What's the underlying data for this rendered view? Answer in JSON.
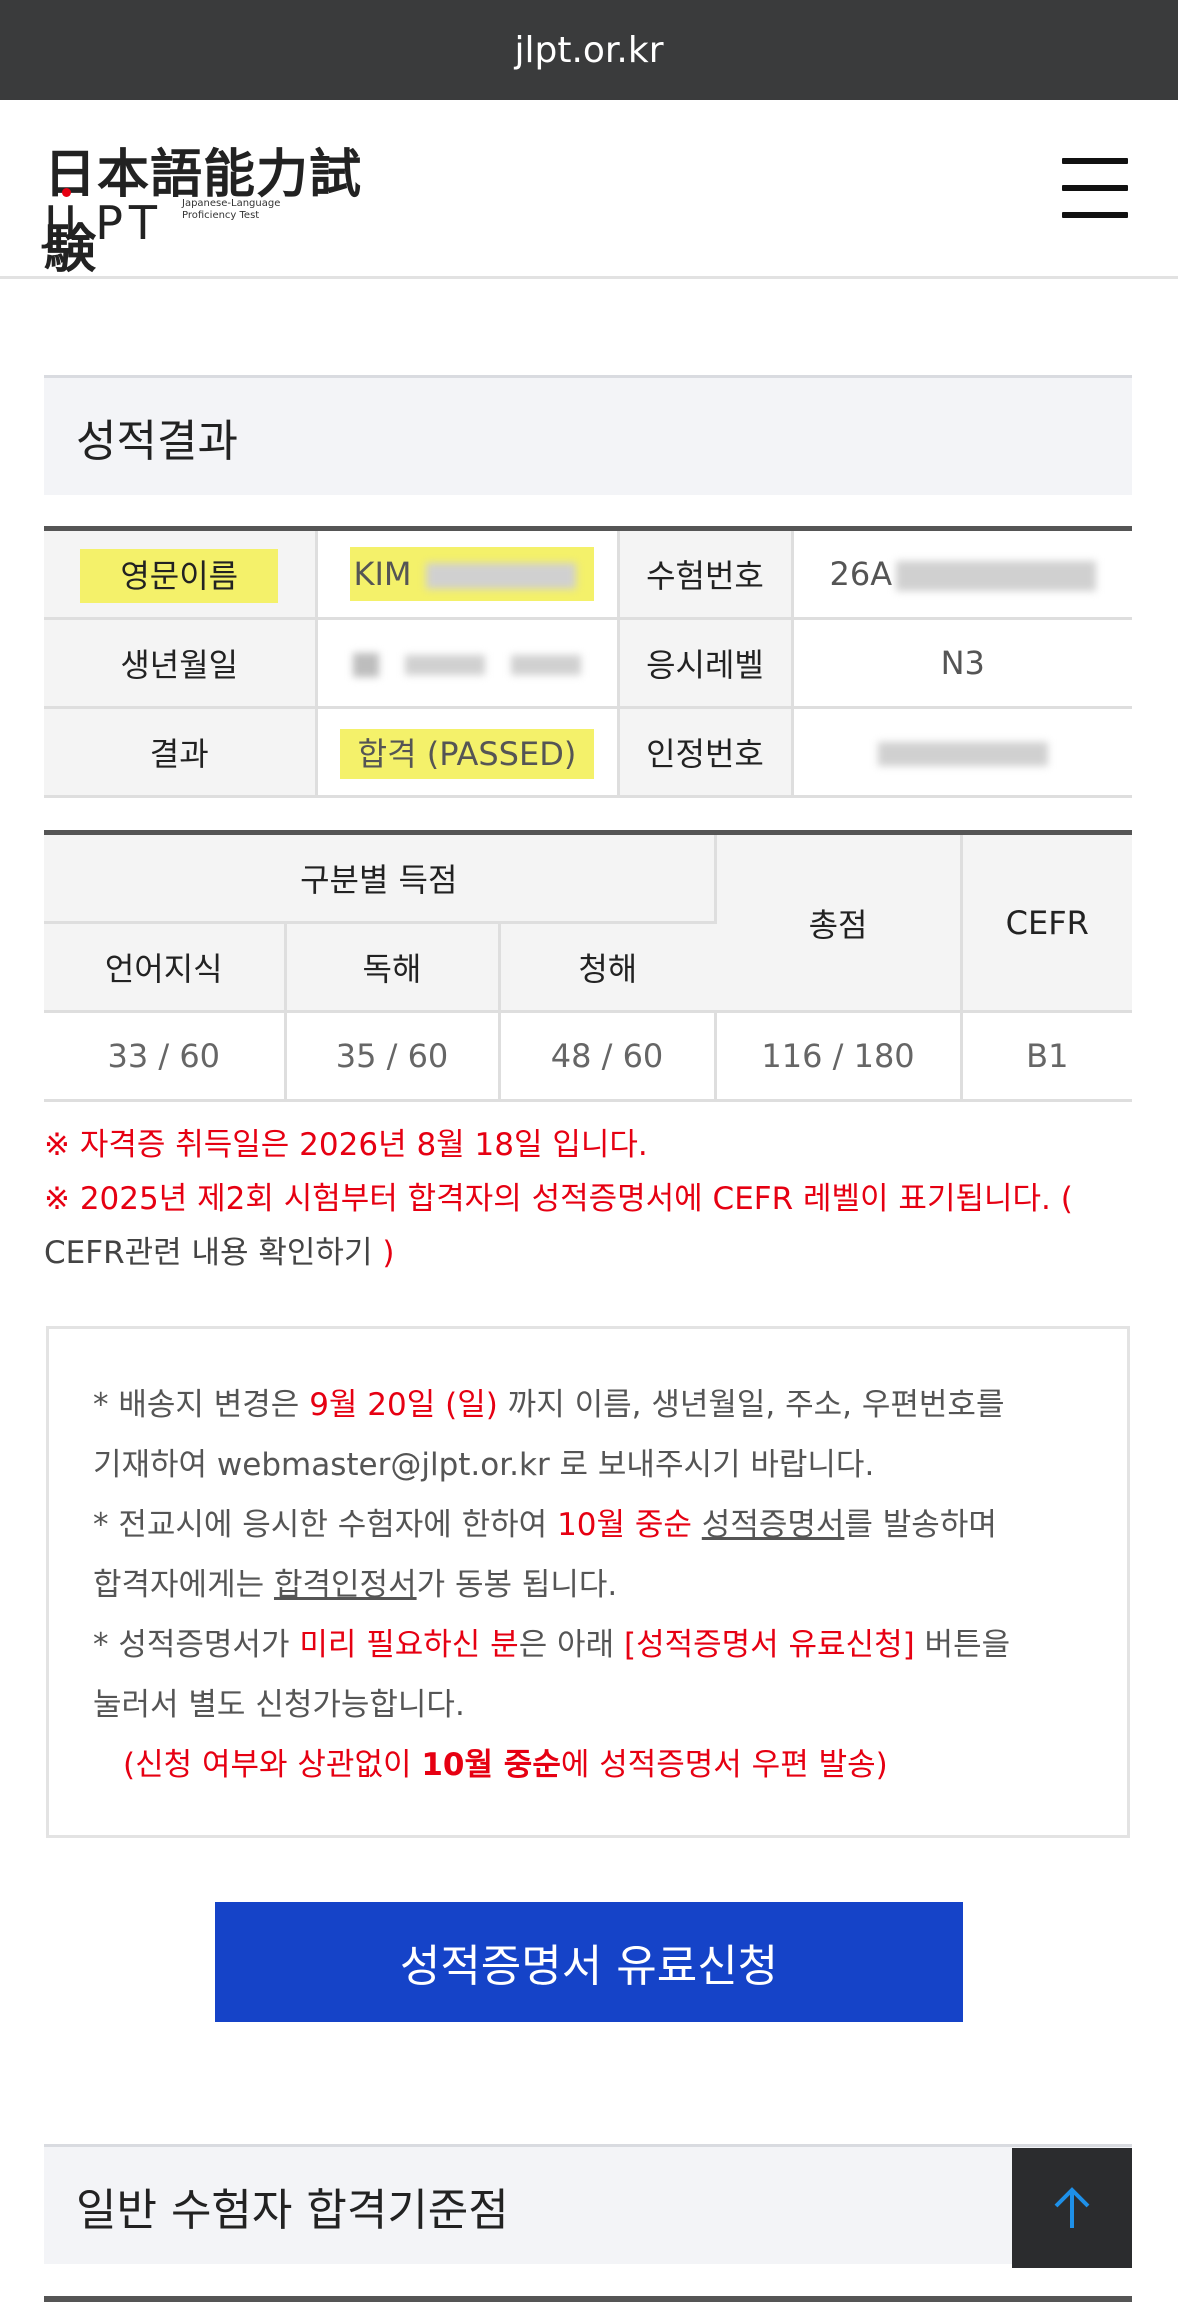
{
  "browser": {
    "url": "jlpt.or.kr"
  },
  "header": {
    "logo_jp": "日本語能力試験",
    "logo_en": "JLPT",
    "logo_sub": "Japanese-Language Proficiency Test",
    "menu_icon": "hamburger-icon"
  },
  "results": {
    "title": "성적결과",
    "info": {
      "name_label": "영문이름",
      "name_value": "KIM",
      "exam_no_label": "수험번호",
      "exam_no_value": "26A",
      "birth_label": "생년월일",
      "level_label": "응시레벨",
      "level_value": "N3",
      "result_label": "결과",
      "result_value": "합격 (PASSED)",
      "cert_no_label": "인정번호"
    },
    "score": {
      "group_header": "구분별 득점",
      "total_header": "총점",
      "cefr_header": "CEFR",
      "columns": [
        "언어지식",
        "독해",
        "청해"
      ],
      "values": [
        "33 / 60",
        "35 / 60",
        "48 / 60"
      ],
      "total": "116 / 180",
      "cefr": "B1"
    },
    "notes": {
      "line1": "※ 자격증 취득일은 2026년 8월 18일 입니다.",
      "line2_a": "※ 2025년 제2회 시험부터 합격자의 성적증명서에 CEFR 레벨이 표기됩니다. (",
      "line2_link": "CEFR관련 내용 확인하기",
      "line2_b": " )"
    }
  },
  "info_box": {
    "p1_a": "* 배송지 변경은 ",
    "p1_red": "9월 20일 (일)",
    "p1_b": " 까지 이름, 생년월일, 주소, 우편번호를",
    "p1_c": "기재하여 webmaster@jlpt.or.kr 로 보내주시기 바랍니다.",
    "p2_a": "* 전교시에 응시한 수험자에 한하여 ",
    "p2_red": "10월 중순",
    "p2_space": " ",
    "p2_u": "성적증명서",
    "p2_b": "를 발송하며",
    "p2_c": "합격자에게는 ",
    "p2_u2": "합격인정서",
    "p2_d": "가 동봉 됩니다.",
    "p3_a": "* 성적증명서가 ",
    "p3_red": "미리 필요하신 분",
    "p3_b": "은 아래 ",
    "p3_red2": "[성적증명서 유료신청]",
    "p3_c": " 버튼을",
    "p3_d": "눌러서 별도 신청가능합니다.",
    "p4_a": "(신청 여부와 상관없이 ",
    "p4_bold": "10월 중순",
    "p4_b": "에 성적증명서 우편 발송)"
  },
  "cta_label": "성적증명서 유료신청",
  "criteria_title": "일반 수험자 합격기준점",
  "colors": {
    "accent": "#1543c8",
    "red": "#e60012",
    "highlight": "#f4f16a",
    "urlbar": "#3a3b3c"
  }
}
